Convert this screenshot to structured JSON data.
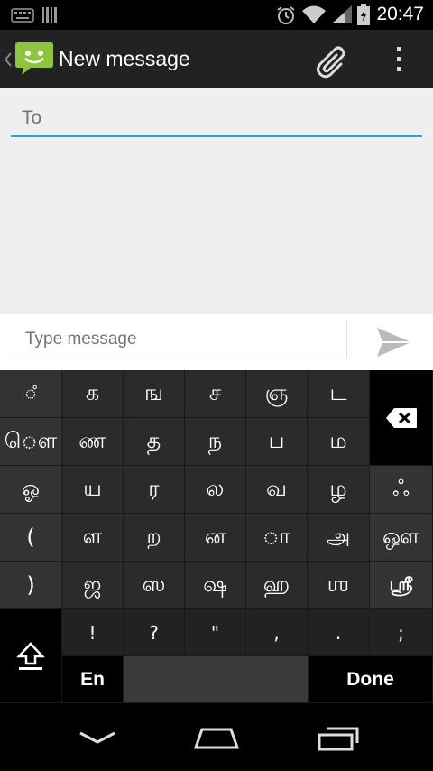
{
  "status_bar": {
    "time": "20:47",
    "icons": [
      "keyboard-icon",
      "barcode-icon",
      "alarm-icon",
      "wifi-icon",
      "signal-icon",
      "battery-icon"
    ]
  },
  "action_bar": {
    "title": "New message",
    "icons": [
      "back-chevron-icon",
      "messaging-app-icon",
      "attach-icon",
      "overflow-menu-icon"
    ]
  },
  "compose": {
    "to_placeholder": "To",
    "message_placeholder": "Type message"
  },
  "keyboard": {
    "side_keys": [
      "ஂ",
      "ௌ",
      "ஓ",
      "(",
      ")"
    ],
    "row1": [
      "க",
      "ங",
      "ச",
      "ஞ",
      "ட"
    ],
    "row2": [
      "ண",
      "த",
      "ந",
      "ப",
      "ம"
    ],
    "row3": [
      "ய",
      "ர",
      "ல",
      "வ",
      "ழ"
    ],
    "row4": [
      "ள",
      "ற",
      "ன",
      "ா",
      "அ"
    ],
    "row5": [
      "ஜ",
      "ஸ",
      "ஷ",
      "ஹ",
      "ஶ"
    ],
    "right_keys": [
      "ஃ",
      "ஔ",
      "ஸ்ரீ"
    ],
    "punctuation": [
      "!",
      "?",
      "\"",
      ",",
      ".",
      ";"
    ],
    "lang_label": "En",
    "done_label": "Done"
  }
}
